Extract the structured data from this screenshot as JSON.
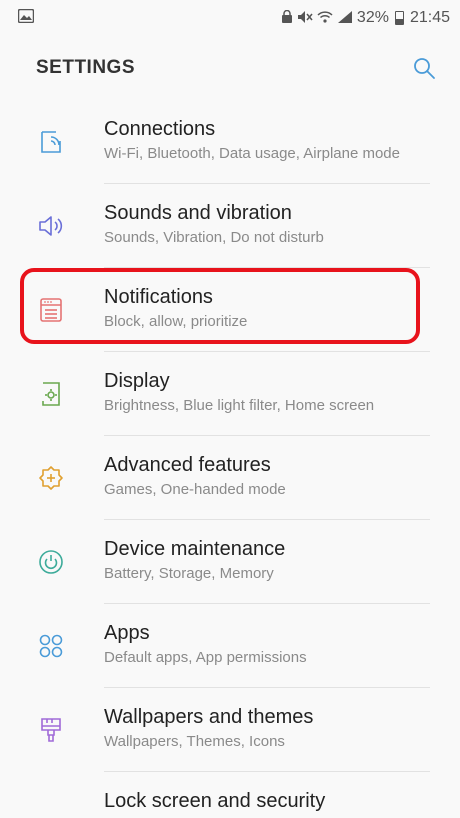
{
  "status_bar": {
    "battery": "32%",
    "time": "21:45"
  },
  "header": {
    "title": "SETTINGS"
  },
  "items": [
    {
      "title": "Connections",
      "subtitle": "Wi-Fi, Bluetooth, Data usage, Airplane mode",
      "icon": "connections-icon",
      "color": "#4a9bd8"
    },
    {
      "title": "Sounds and vibration",
      "subtitle": "Sounds, Vibration, Do not disturb",
      "icon": "speaker-icon",
      "color": "#6a6fd8"
    },
    {
      "title": "Notifications",
      "subtitle": "Block, allow, prioritize",
      "icon": "notifications-icon",
      "color": "#e57373"
    },
    {
      "title": "Display",
      "subtitle": "Brightness, Blue light filter, Home screen",
      "icon": "display-icon",
      "color": "#6aa84f"
    },
    {
      "title": "Advanced features",
      "subtitle": "Games, One-handed mode",
      "icon": "advanced-features-icon",
      "color": "#e0a030"
    },
    {
      "title": "Device maintenance",
      "subtitle": "Battery, Storage, Memory",
      "icon": "device-maintenance-icon",
      "color": "#3dab9a"
    },
    {
      "title": "Apps",
      "subtitle": "Default apps, App permissions",
      "icon": "apps-icon",
      "color": "#4a9bd8"
    },
    {
      "title": "Wallpapers and themes",
      "subtitle": "Wallpapers, Themes, Icons",
      "icon": "paintbrush-icon",
      "color": "#a06ad8"
    },
    {
      "title": "Lock screen and security",
      "subtitle": "",
      "icon": "lock-icon",
      "color": "#4a9bd8"
    }
  ],
  "highlight": {
    "target": "Notifications",
    "color": "#e8131c"
  }
}
